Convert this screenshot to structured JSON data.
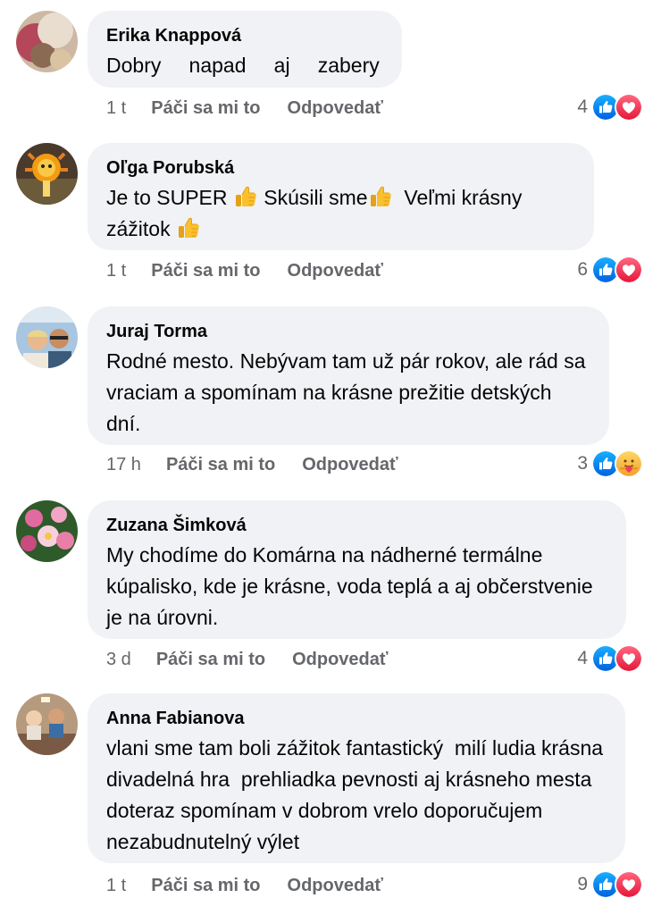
{
  "comments": [
    {
      "author": "Erika Knappová",
      "text": "Dobry   napad   aj   zabery",
      "time": "1 t",
      "like_label": "Páči sa mi to",
      "reply_label": "Odpovedať",
      "reaction_count": "4",
      "reactions": [
        "like",
        "love"
      ]
    },
    {
      "author": "Oľga Porubská",
      "text_parts": [
        "Je to SUPER ",
        " Skúsili sme",
        "  Veľmi krásny zážitok "
      ],
      "time": "1 t",
      "like_label": "Páči sa mi to",
      "reply_label": "Odpovedať",
      "reaction_count": "6",
      "reactions": [
        "like",
        "love"
      ]
    },
    {
      "author": "Juraj Torma",
      "text": "Rodné mesto. Nebývam tam už pár rokov, ale rád sa vraciam a spomínam na krásne prežitie detských dní.",
      "time": "17 h",
      "like_label": "Páči sa mi to",
      "reply_label": "Odpovedať",
      "reaction_count": "3",
      "reactions": [
        "like",
        "care"
      ]
    },
    {
      "author": "Zuzana Šimková",
      "text": "My chodíme do Komárna na nádherné termálne kúpalisko, kde je krásne, voda teplá a aj občerstvenie je na úrovni.",
      "time": "3 d",
      "like_label": "Páči sa mi to",
      "reply_label": "Odpovedať",
      "reaction_count": "4",
      "reactions": [
        "like",
        "love"
      ]
    },
    {
      "author": "Anna Fabianova",
      "text": "vlani sme tam boli zážitok fantastický  milí ludia krásna divadelná hra  prehliadka pevnosti aj krásneho mesta doteraz spomínam v dobrom vrelo doporučujem  nezabudnutelný výlet",
      "time": "1 t",
      "like_label": "Páči sa mi to",
      "reply_label": "Odpovedať",
      "reaction_count": "9",
      "reactions": [
        "like",
        "love"
      ]
    }
  ],
  "colors": {
    "bubble": "#f0f2f5",
    "meta": "#65676b",
    "like_blue": "#1877f2",
    "love_red": "#f33e58",
    "care_yellow": "#f7b125"
  }
}
